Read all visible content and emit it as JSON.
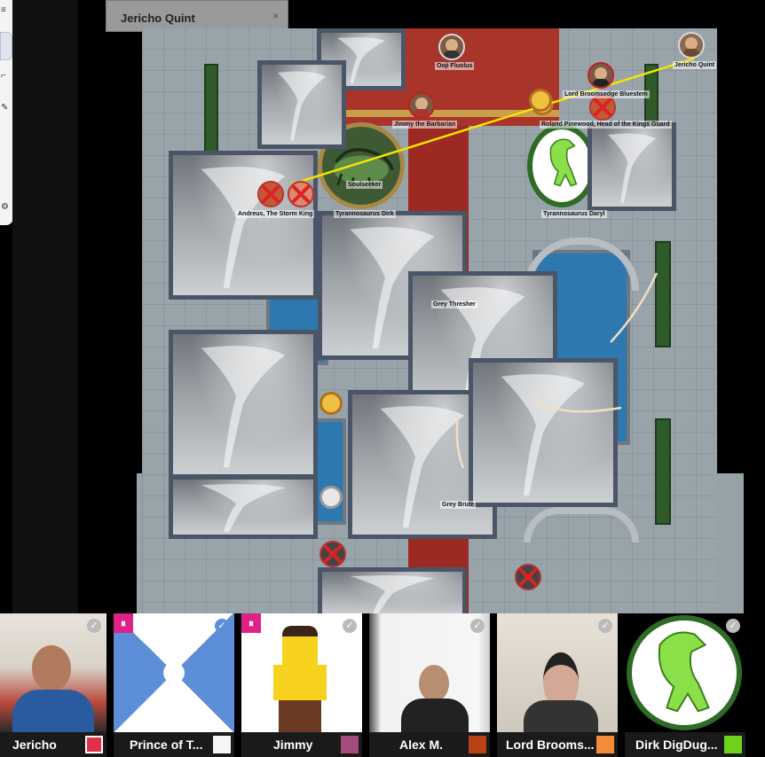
{
  "app": {
    "selected_character_tab": "Jericho Quint",
    "close_symbol": "×"
  },
  "toolbar": {
    "icons": [
      "menu-icon",
      "select-icon",
      "ruler-icon",
      "draw-icon",
      "gear-icon"
    ]
  },
  "map": {
    "tokens": [
      {
        "label": "Ooji Fluolus"
      },
      {
        "label": "Jericho Quint"
      },
      {
        "label": "Lord Broomsedge Bluestem"
      },
      {
        "label": "Jimmy the Barbarian"
      },
      {
        "label": "Roland Pinewood, Head of the Kings Guard"
      },
      {
        "label": "Soulseeker"
      },
      {
        "label": "Andreus, The Storm King"
      },
      {
        "label": "Tyrannosaurus Dirk"
      },
      {
        "label": "Tyrannosaurus Daryl"
      },
      {
        "label": "Grey Thresher"
      },
      {
        "label": "Grey Brute"
      }
    ]
  },
  "participants": [
    {
      "name": "Jericho",
      "color": "#e0304a",
      "paused": false
    },
    {
      "name": "Prince of T...",
      "color": "#f5f5f5",
      "paused": true
    },
    {
      "name": "Jimmy",
      "color": "#a24d7e",
      "paused": true
    },
    {
      "name": "Alex M.",
      "color": "#b84314",
      "paused": false
    },
    {
      "name": "Lord Brooms...",
      "color": "#f28c38",
      "paused": false
    },
    {
      "name": "Dirk DigDug...",
      "color": "#6ed11b",
      "paused": false
    }
  ],
  "colors": {
    "ruler_line": "#f5e300",
    "dead_marker": "#d22222",
    "tornado_border": "#4b5568"
  }
}
